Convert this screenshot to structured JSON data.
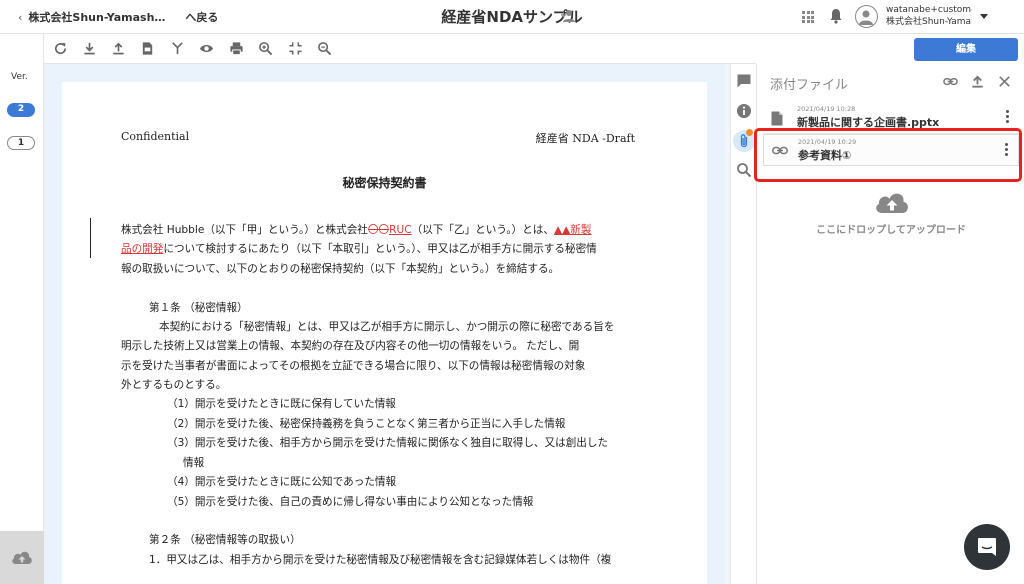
{
  "header": {
    "back_org": "株式会社Shun-Yamash…",
    "back_label": "へ戻る",
    "title": "経産省NDAサンプル",
    "user_email": "watanabe+custom@…",
    "user_org": "株式会社Shun-Yama…"
  },
  "version_rail": {
    "label": "Ver.",
    "versions": [
      "2",
      "1"
    ],
    "active_version": "2"
  },
  "toolbar": {
    "tools": [
      "refresh-icon",
      "download-icon",
      "upload-icon",
      "convert-icon",
      "merge-icon",
      "eye-icon",
      "print-icon",
      "zoom-in-icon",
      "fit-icon",
      "zoom-out-icon"
    ]
  },
  "edit_button": {
    "label": "編集"
  },
  "document": {
    "header_left": "Confidential",
    "header_right": "経産省 NDA -Draft",
    "heading": "秘密保持契約書",
    "intro": {
      "line1_a": "株式会社 Hubble（以下「甲」という。）と株式会社",
      "line1_strike": "〇〇",
      "line1_ins": "RUC",
      "line1_b": "（以下「乙」という。）とは、",
      "line1_mark": "▲▲新製",
      "line2_ins": "品の開発",
      "line2_b": "について検討するにあたり（以下「本取引」という。）、甲又は乙が相手方に開示する秘密情",
      "line3": "報の取扱いについて、以下のとおりの秘密保持契約（以下「本契約」という。）を締結する。"
    },
    "article1": {
      "title": "第１条 （秘密情報）",
      "body": [
        "本契約における「秘密情報」とは、甲又は乙が相手方に開示し、かつ開示の際に秘密である旨を",
        "明示した技術上又は営業上の情報、本契約の存在及び内容その他一切の情報をいう。 ただし、開",
        "示を受けた当事者が書面によってその根拠を立証できる場合に限り、以下の情報は秘密情報の対象",
        "外とするものとする。"
      ],
      "items": [
        "（1）開示を受けたときに既に保有していた情報",
        "（2）開示を受けた後、秘密保持義務を負うことなく第三者から正当に入手した情報",
        "（3）開示を受けた後、相手方から開示を受けた情報に関係なく独自に取得し、又は創出した",
        "情報",
        "（4）開示を受けたときに既に公知であった情報",
        "（5）開示を受けた後、自己の責めに帰し得ない事由により公知となった情報"
      ]
    },
    "article2": {
      "title": "第２条 （秘密情報等の取扱い）",
      "first_line": "1．甲又は乙は、相手方から開示を受けた秘密情報及び秘密情報を含む記録媒体若しくは物件（複"
    }
  },
  "attachments": {
    "title": "添付ファイル",
    "files": [
      {
        "date": "2021/04/19 10:28",
        "name": "新製品に関する企画書.pptx",
        "icon": "file-icon"
      },
      {
        "date": "2021/04/19 10:29",
        "name": "参考資料①",
        "icon": "link-icon"
      }
    ],
    "drop_text": "ここにドロップしてアップロード"
  },
  "colors": {
    "accent": "#3d7ad6",
    "highlight": "#e8221e",
    "insert_red": "#d93838",
    "notification": "#f28a2e"
  }
}
